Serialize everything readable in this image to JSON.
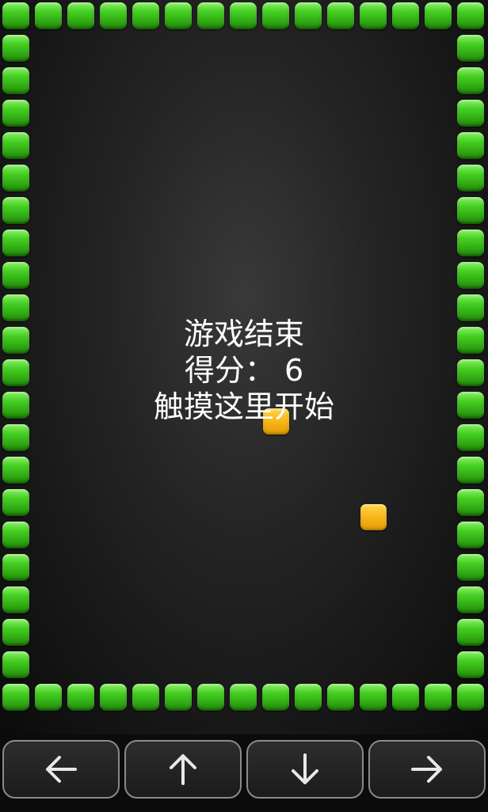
{
  "game": {
    "message": {
      "line1": "游戏结束",
      "line2": "得分： 6",
      "line3": "触摸这里开始"
    },
    "score": 6
  },
  "controls": [
    {
      "name": "left",
      "icon": "arrow-left-icon"
    },
    {
      "name": "up",
      "icon": "arrow-up-icon"
    },
    {
      "name": "down",
      "icon": "arrow-down-icon"
    },
    {
      "name": "right",
      "icon": "arrow-right-icon"
    }
  ],
  "colors": {
    "wall": "#45cf22",
    "food": "#f8b61a",
    "background": "#262626",
    "text": "#ffffff"
  }
}
